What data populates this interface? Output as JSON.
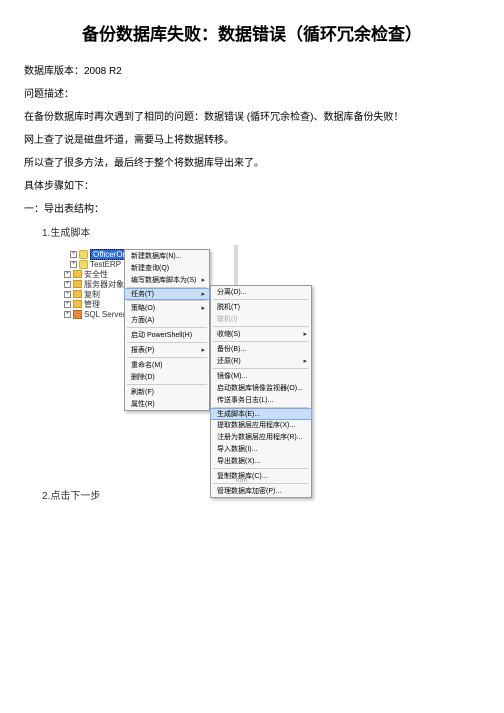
{
  "title": "备份数据库失败：数据错误（循环冗余检查）",
  "paras": {
    "p1": "数据库版本：2008 R2",
    "p2": "问题描述：",
    "p3": "在备份数据库时再次遇到了相同的问题：数据错误 (循环冗余检查)、数据库备份失败！",
    "p4": "网上查了说是磁盘坏道，需要马上将数据转移。",
    "p5": "所以查了很多方法，最后终于整个将数据库导出来了。",
    "p6": "具体步骤如下：",
    "p7": "一：导出表结构：",
    "step1": "1.生成脚本",
    "step2": "2.点击下⼀步"
  },
  "tree": {
    "db1": "OfficerOnline",
    "db2": "TestERP",
    "t1": "安全性",
    "t2": "服务器对象",
    "t3": "复制",
    "t4": "管理",
    "t5": "SQL Server..."
  },
  "menu1": {
    "m1": "新建数据库(N)...",
    "m2": "新建查询(Q)",
    "m3": "编写数据库脚本为(S)",
    "m4": "任务(T)",
    "m5": "策略(O)",
    "m6": "方面(A)",
    "m7": "启动 PowerShell(H)",
    "m8": "报表(P)",
    "m9": "重命名(M)",
    "m10": "删除(D)",
    "m11": "刷新(F)",
    "m12": "属性(R)"
  },
  "menu2": {
    "n1": "分离(D)...",
    "n2": "脱机(T)",
    "n3": "联机(I)",
    "n4": "收缩(S)",
    "n5": "备份(B)...",
    "n6": "还原(R)",
    "n7": "镜像(M)...",
    "n8": "启动数据库镜像监视器(O)...",
    "n9": "传送事务日志(L)...",
    "n10": "生成脚本(E)...",
    "n11": "提取数据层应用程序(X)...",
    "n12": "注册为数据层应用程序(R)...",
    "n13": "导入数据(I)...",
    "n14": "导出数据(X)...",
    "n15": "复制数据库(C)...",
    "n16": "管理数据库加密(P)..."
  }
}
